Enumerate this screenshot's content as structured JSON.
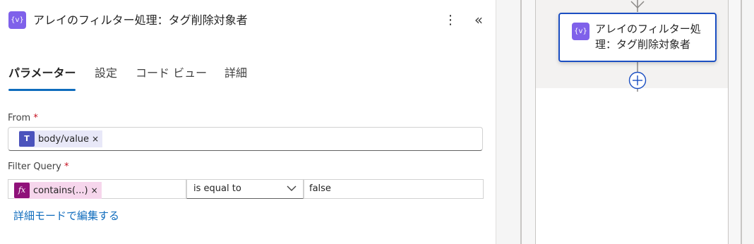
{
  "header": {
    "icon_text": "{v}",
    "title": "アレイのフィルター処理：タグ削除対象者",
    "more_glyph": "⋮",
    "collapse_glyph": "«"
  },
  "tabs": [
    {
      "label": "パラメーター",
      "active": true
    },
    {
      "label": "設定",
      "active": false
    },
    {
      "label": "コード ビュー",
      "active": false
    },
    {
      "label": "詳細",
      "active": false
    }
  ],
  "from": {
    "label": "From",
    "required": "*",
    "token": {
      "icon": "teams-icon",
      "icon_text": "T",
      "text": "body/value",
      "remove": "×"
    }
  },
  "filter_query": {
    "label": "Filter Query",
    "required": "*",
    "left_token": {
      "icon": "fx-icon",
      "icon_text": "fx",
      "text": "contains(...)",
      "remove": "×"
    },
    "operator": "is equal to",
    "right_value": "false"
  },
  "advanced_link": "詳細モードで編集する",
  "canvas": {
    "node": {
      "icon_text": "{v}",
      "title": "アレイのフィルター処理：タグ削除対象者"
    }
  },
  "colors": {
    "accent": "#0f6cbd",
    "action_icon": "#7f61ea",
    "teams": "#4b53bc",
    "expression": "#8f1179",
    "required": "#c50f1f",
    "node_border": "#1b4fc2"
  }
}
